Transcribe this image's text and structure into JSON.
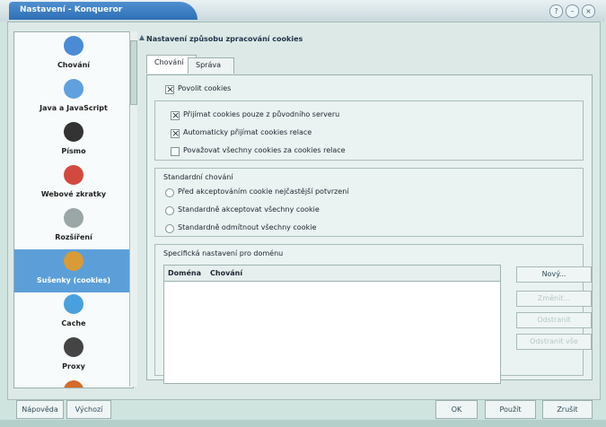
{
  "window": {
    "title": "Nastavení - Konqueror"
  },
  "sidebar": {
    "items": [
      {
        "label": "Chování",
        "icon": "gear-icon",
        "color": "#4a8bd7"
      },
      {
        "label": "Java a JavaScript",
        "icon": "java-icon",
        "color": "#5fa0df"
      },
      {
        "label": "Písmo",
        "icon": "font-icon",
        "color": "#333333"
      },
      {
        "label": "Webové zkratky",
        "icon": "shortcut-icon",
        "color": "#d24a3f"
      },
      {
        "label": "Rozšíření",
        "icon": "puzzle-icon",
        "color": "#9aa7a6"
      },
      {
        "label": "Sušenky (cookies)",
        "icon": "cookie-icon",
        "color": "#d89b37"
      },
      {
        "label": "Cache",
        "icon": "cache-icon",
        "color": "#49a0df"
      },
      {
        "label": "Proxy",
        "icon": "proxy-icon",
        "color": "#444444"
      },
      {
        "label": "",
        "icon": "security-icon",
        "color": "#d56b28"
      }
    ]
  },
  "main": {
    "title": "Nastavení způsobu zpracování cookies",
    "tabs": [
      "Chování",
      "Správa"
    ],
    "options": {
      "enable_cookies": "Povolit cookies",
      "accept_origin": "Přijímat cookies pouze z původního serveru",
      "auto_accept_session": "Automaticky přijímat cookies relace",
      "treat_all_session": "Považovat všechny cookies za cookies relace"
    },
    "default_policy": {
      "title": "Standardní chování",
      "options": [
        "Před akceptováním cookie nejčastější potvrzení",
        "Standardně akceptovat všechny cookie",
        "Standardně odmítnout všechny cookie"
      ]
    },
    "specific_policy": {
      "title": "Specifická nastavení pro doménu",
      "columns": [
        "Doména",
        "Chování"
      ],
      "buttons": [
        "Nový...",
        "Změnit...",
        "Odstranit",
        "Odstranit vše"
      ]
    }
  },
  "footer": {
    "left_buttons": [
      "Nápověda",
      "Výchozí"
    ],
    "right_buttons": [
      "OK",
      "Použít",
      "Zrušit"
    ]
  }
}
